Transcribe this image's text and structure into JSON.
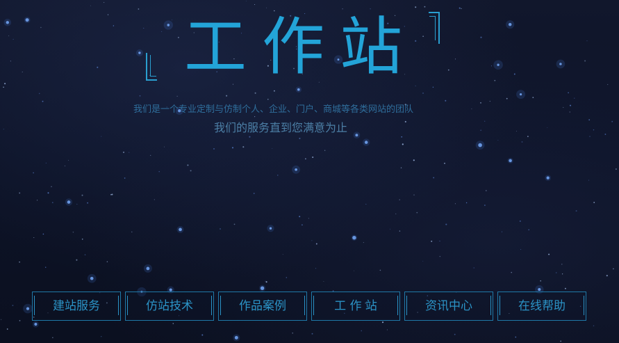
{
  "header": {
    "title": "工作站",
    "subtitle": "我们是一个专业定制与仿制个人、企业、门户、商城等各类网站的团队",
    "tagline": "我们的服务直到您满意为止"
  },
  "nav": {
    "items": [
      {
        "label": "建站服务"
      },
      {
        "label": "仿站技术"
      },
      {
        "label": "作品案例"
      },
      {
        "label": "工 作 站"
      },
      {
        "label": "资讯中心"
      },
      {
        "label": "在线帮助"
      }
    ]
  },
  "colors": {
    "accent": "#23a4d8",
    "background": "#0c1122",
    "border": "#1f79a8"
  }
}
